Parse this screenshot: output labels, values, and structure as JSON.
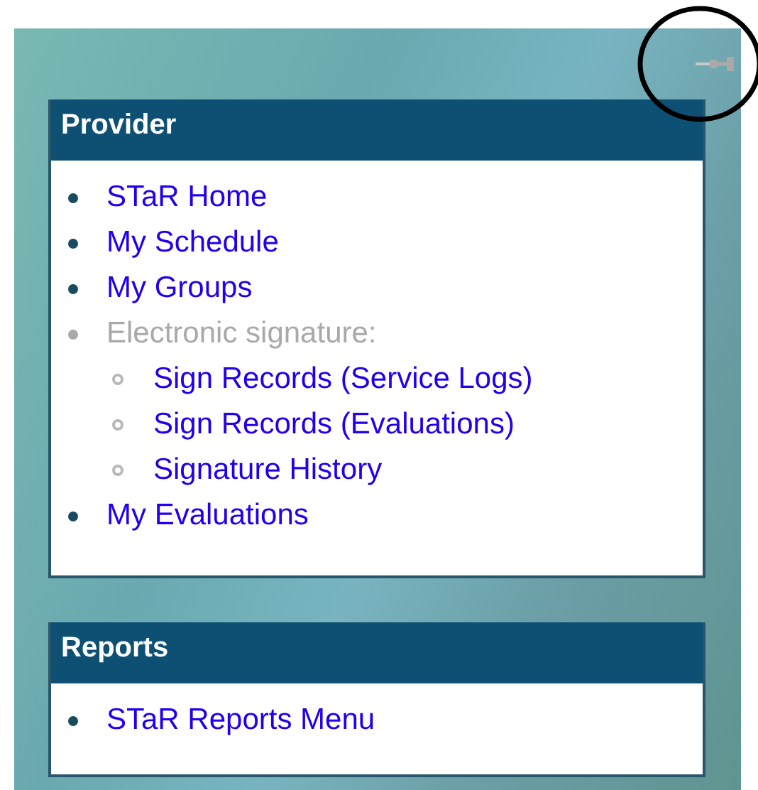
{
  "panels": [
    {
      "title": "Provider",
      "items": [
        {
          "label": "STaR Home",
          "disabled": false
        },
        {
          "label": "My Schedule",
          "disabled": false
        },
        {
          "label": "My Groups",
          "disabled": false
        },
        {
          "label": "Electronic signature:",
          "disabled": true,
          "children": [
            {
              "label": "Sign Records (Service Logs)",
              "disabled": false
            },
            {
              "label": "Sign Records (Evaluations)",
              "disabled": false
            },
            {
              "label": "Signature History",
              "disabled": false
            }
          ]
        },
        {
          "label": "My Evaluations",
          "disabled": false
        }
      ]
    },
    {
      "title": "Reports",
      "items": [
        {
          "label": "STaR Reports Menu",
          "disabled": false
        }
      ]
    }
  ]
}
